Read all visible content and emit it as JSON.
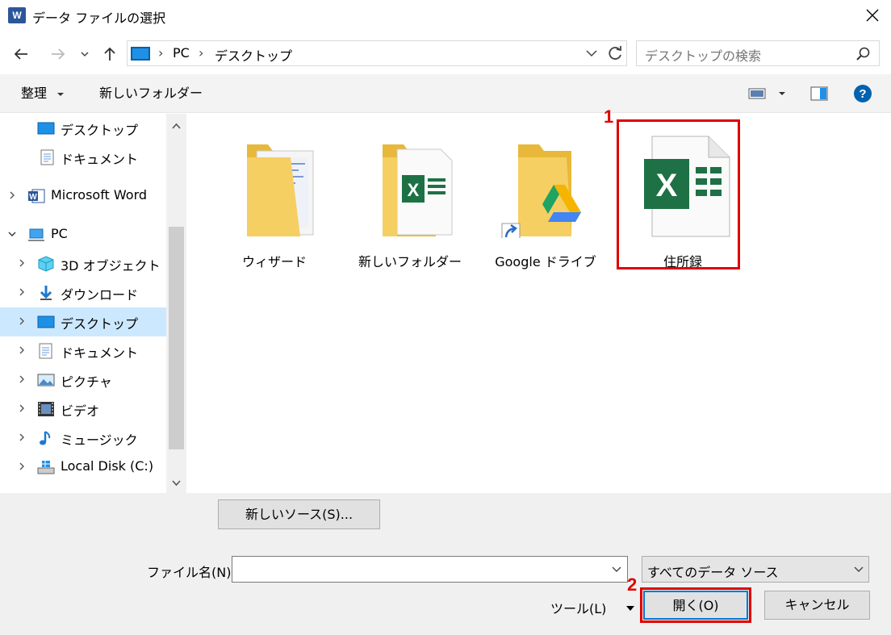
{
  "window": {
    "title": "データ ファイルの選択",
    "app_icon_letter": "W"
  },
  "address": {
    "segments": [
      "PC",
      "デスクトップ"
    ]
  },
  "search": {
    "placeholder": "デスクトップの検索"
  },
  "toolbar": {
    "organize_label": "整理",
    "new_folder_label": "新しいフォルダー"
  },
  "sidebar": {
    "items": [
      {
        "label": "デスクトップ",
        "icon": "desktop-icon"
      },
      {
        "label": "ドキュメント",
        "icon": "document-icon"
      },
      {
        "label": "Microsoft Word",
        "icon": "word-icon"
      },
      {
        "label": "PC",
        "icon": "pc-icon"
      },
      {
        "label": "3D オブジェクト",
        "icon": "3d-objects-icon"
      },
      {
        "label": "ダウンロード",
        "icon": "download-icon"
      },
      {
        "label": "デスクトップ",
        "icon": "desktop-icon",
        "selected": true
      },
      {
        "label": "ドキュメント",
        "icon": "document-icon"
      },
      {
        "label": "ピクチャ",
        "icon": "pictures-icon"
      },
      {
        "label": "ビデオ",
        "icon": "video-icon"
      },
      {
        "label": "ミュージック",
        "icon": "music-icon"
      },
      {
        "label": "Local Disk (C:)",
        "icon": "disk-icon"
      }
    ]
  },
  "files": [
    {
      "label": "ウィザード",
      "icon": "folder-icon"
    },
    {
      "label": "新しいフォルダー",
      "icon": "folder-excel-icon"
    },
    {
      "label": "Google ドライブ",
      "icon": "folder-google-drive-icon"
    },
    {
      "label": "住所録",
      "icon": "excel-file-icon"
    }
  ],
  "annotations": {
    "step1": "1",
    "step2": "2"
  },
  "bottom": {
    "new_source_label": "新しいソース(S)...",
    "filename_label": "ファイル名(N):",
    "filename_value": "",
    "filter_value": "すべてのデータ ソース",
    "tools_label": "ツール(L)",
    "open_label": "開く(O)",
    "cancel_label": "キャンセル"
  },
  "colors": {
    "accent": "#0078d7",
    "highlight": "#e00000",
    "excel_green": "#1e7145",
    "selected_bg": "#cce8ff"
  }
}
